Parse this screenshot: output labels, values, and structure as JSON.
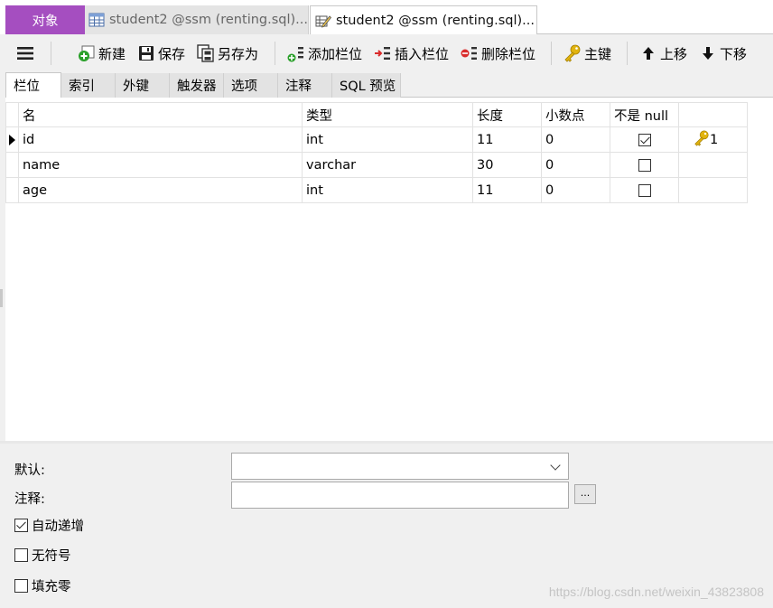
{
  "window_tabs": {
    "objects": "对象",
    "tab1": "student2 @ssm (renting.sql)...",
    "tab2": "student2 @ssm (renting.sql)..."
  },
  "toolbar": {
    "new": "新建",
    "save": "保存",
    "save_as": "另存为",
    "add_column": "添加栏位",
    "insert_column": "插入栏位",
    "delete_column": "删除栏位",
    "primary_key": "主键",
    "move_up": "上移",
    "move_down": "下移"
  },
  "inner_tabs": [
    "栏位",
    "索引",
    "外键",
    "触发器",
    "选项",
    "注释",
    "SQL 预览"
  ],
  "grid": {
    "headers": [
      "名",
      "类型",
      "长度",
      "小数点",
      "不是 null",
      ""
    ],
    "rows": [
      {
        "name": "id",
        "type": "int",
        "length": "11",
        "decimals": "0",
        "not_null": true,
        "key": "1",
        "selected": true
      },
      {
        "name": "name",
        "type": "varchar",
        "length": "30",
        "decimals": "0",
        "not_null": false,
        "key": "",
        "selected": false
      },
      {
        "name": "age",
        "type": "int",
        "length": "11",
        "decimals": "0",
        "not_null": false,
        "key": "",
        "selected": false
      }
    ]
  },
  "properties": {
    "default_label": "默认:",
    "default_value": "",
    "comment_label": "注释:",
    "comment_value": "",
    "dots_label": "...",
    "auto_increment_label": "自动递增",
    "auto_increment": true,
    "unsigned_label": "无符号",
    "unsigned": false,
    "zerofill_label": "填充零",
    "zerofill": false
  },
  "watermark": "https://blog.csdn.net/weixin_43823808",
  "colors": {
    "objects_tab": "#a54ec0",
    "key_icon": "#e2b40f",
    "add_icon": "#2aa02a",
    "delete_icon": "#d92b2b"
  }
}
